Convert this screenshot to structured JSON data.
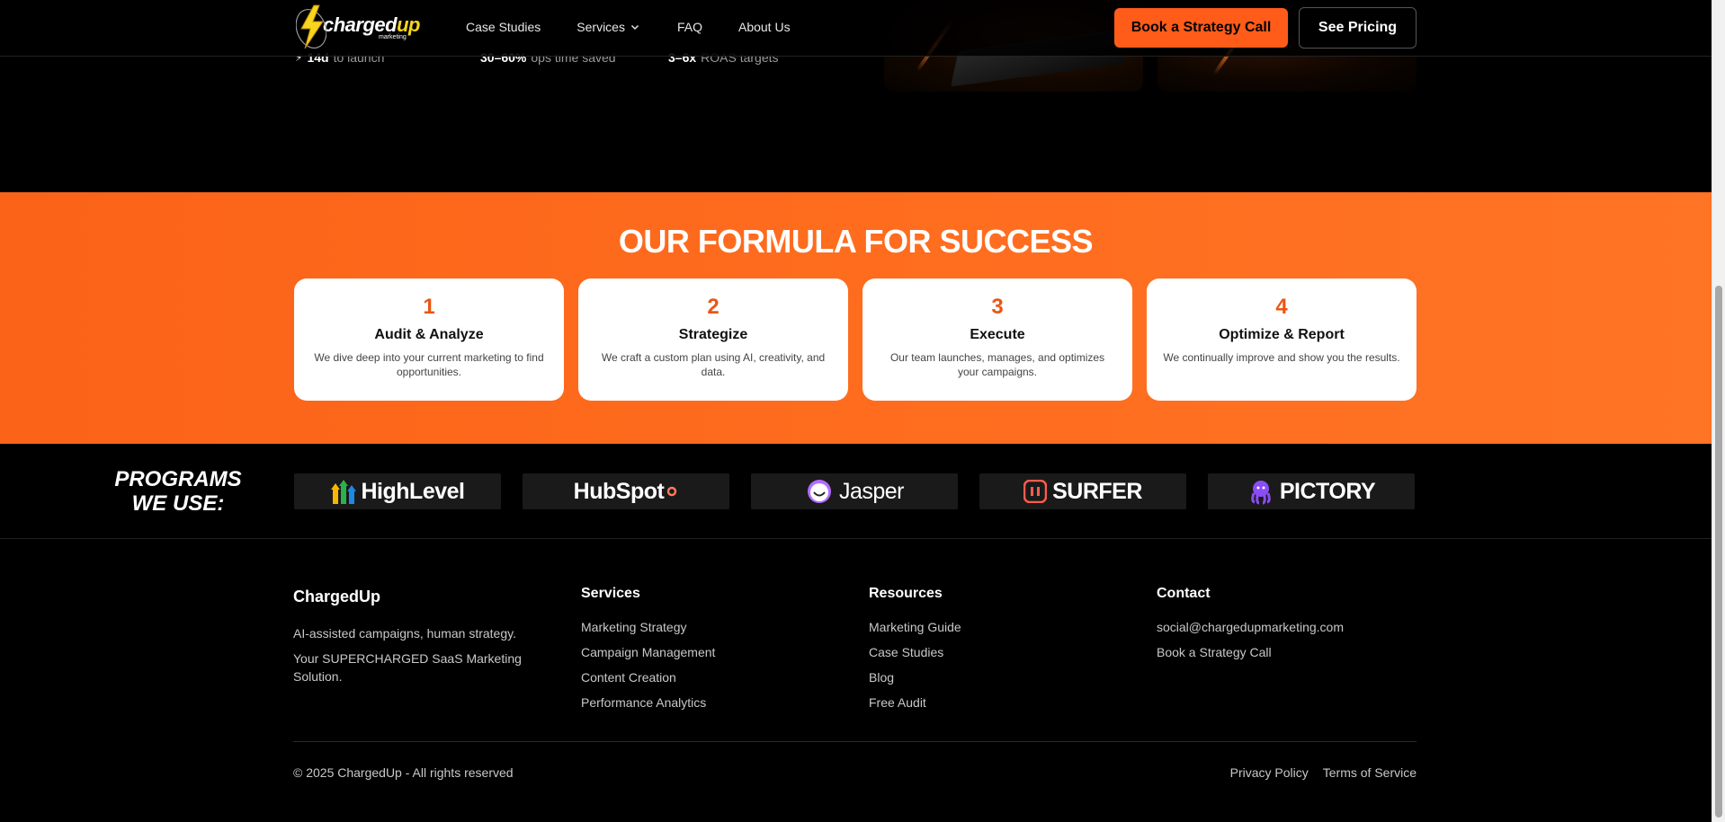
{
  "header": {
    "logo": {
      "word_main": "charged",
      "word_accent": "up",
      "sub": "marketing"
    },
    "nav": [
      "Case Studies",
      "Services",
      "FAQ",
      "About Us"
    ],
    "cta_primary": "Book a Strategy Call",
    "cta_secondary": "See Pricing"
  },
  "hero": {
    "stats": [
      {
        "value": "14d",
        "label": "to launch"
      },
      {
        "value": "30–60%",
        "label": "ops time saved"
      },
      {
        "value": "3–6x",
        "label": "ROAS targets"
      }
    ]
  },
  "formula": {
    "title": "OUR FORMULA FOR SUCCESS",
    "steps": [
      {
        "num": "1",
        "title": "Audit & Analyze",
        "desc": "We dive deep into your current marketing to find opportunities."
      },
      {
        "num": "2",
        "title": "Strategize",
        "desc": "We craft a custom plan using AI, creativity, and data."
      },
      {
        "num": "3",
        "title": "Execute",
        "desc": "Our team launches, manages, and optimizes your campaigns."
      },
      {
        "num": "4",
        "title": "Optimize & Report",
        "desc": "We continually improve and show you the results."
      }
    ]
  },
  "programs": {
    "label_line1": "PROGRAMS",
    "label_line2": "WE USE:",
    "tools": [
      "HighLevel",
      "HubSpot",
      "Jasper",
      "SURFER",
      "PICTORY"
    ]
  },
  "footer": {
    "brand": {
      "name": "ChargedUp",
      "tagline": "AI-assisted campaigns, human strategy.",
      "desc": "Your SUPERCHARGED SaaS Marketing Solution."
    },
    "services": {
      "heading": "Services",
      "links": [
        "Marketing Strategy",
        "Campaign Management",
        "Content Creation",
        "Performance Analytics"
      ]
    },
    "resources": {
      "heading": "Resources",
      "links": [
        "Marketing Guide",
        "Case Studies",
        "Blog",
        "Free Audit"
      ]
    },
    "contact": {
      "heading": "Contact",
      "links": [
        "social@chargedupmarketing.com",
        "Book a Strategy Call"
      ]
    },
    "copyright": "© 2025 ChargedUp - All rights reserved",
    "legal": [
      "Privacy Policy",
      "Terms of Service"
    ]
  },
  "colors": {
    "accent": "#ff5c1a",
    "accent_dark": "#ea5614",
    "logo_yellow": "#f7d51d",
    "background": "#000000"
  }
}
